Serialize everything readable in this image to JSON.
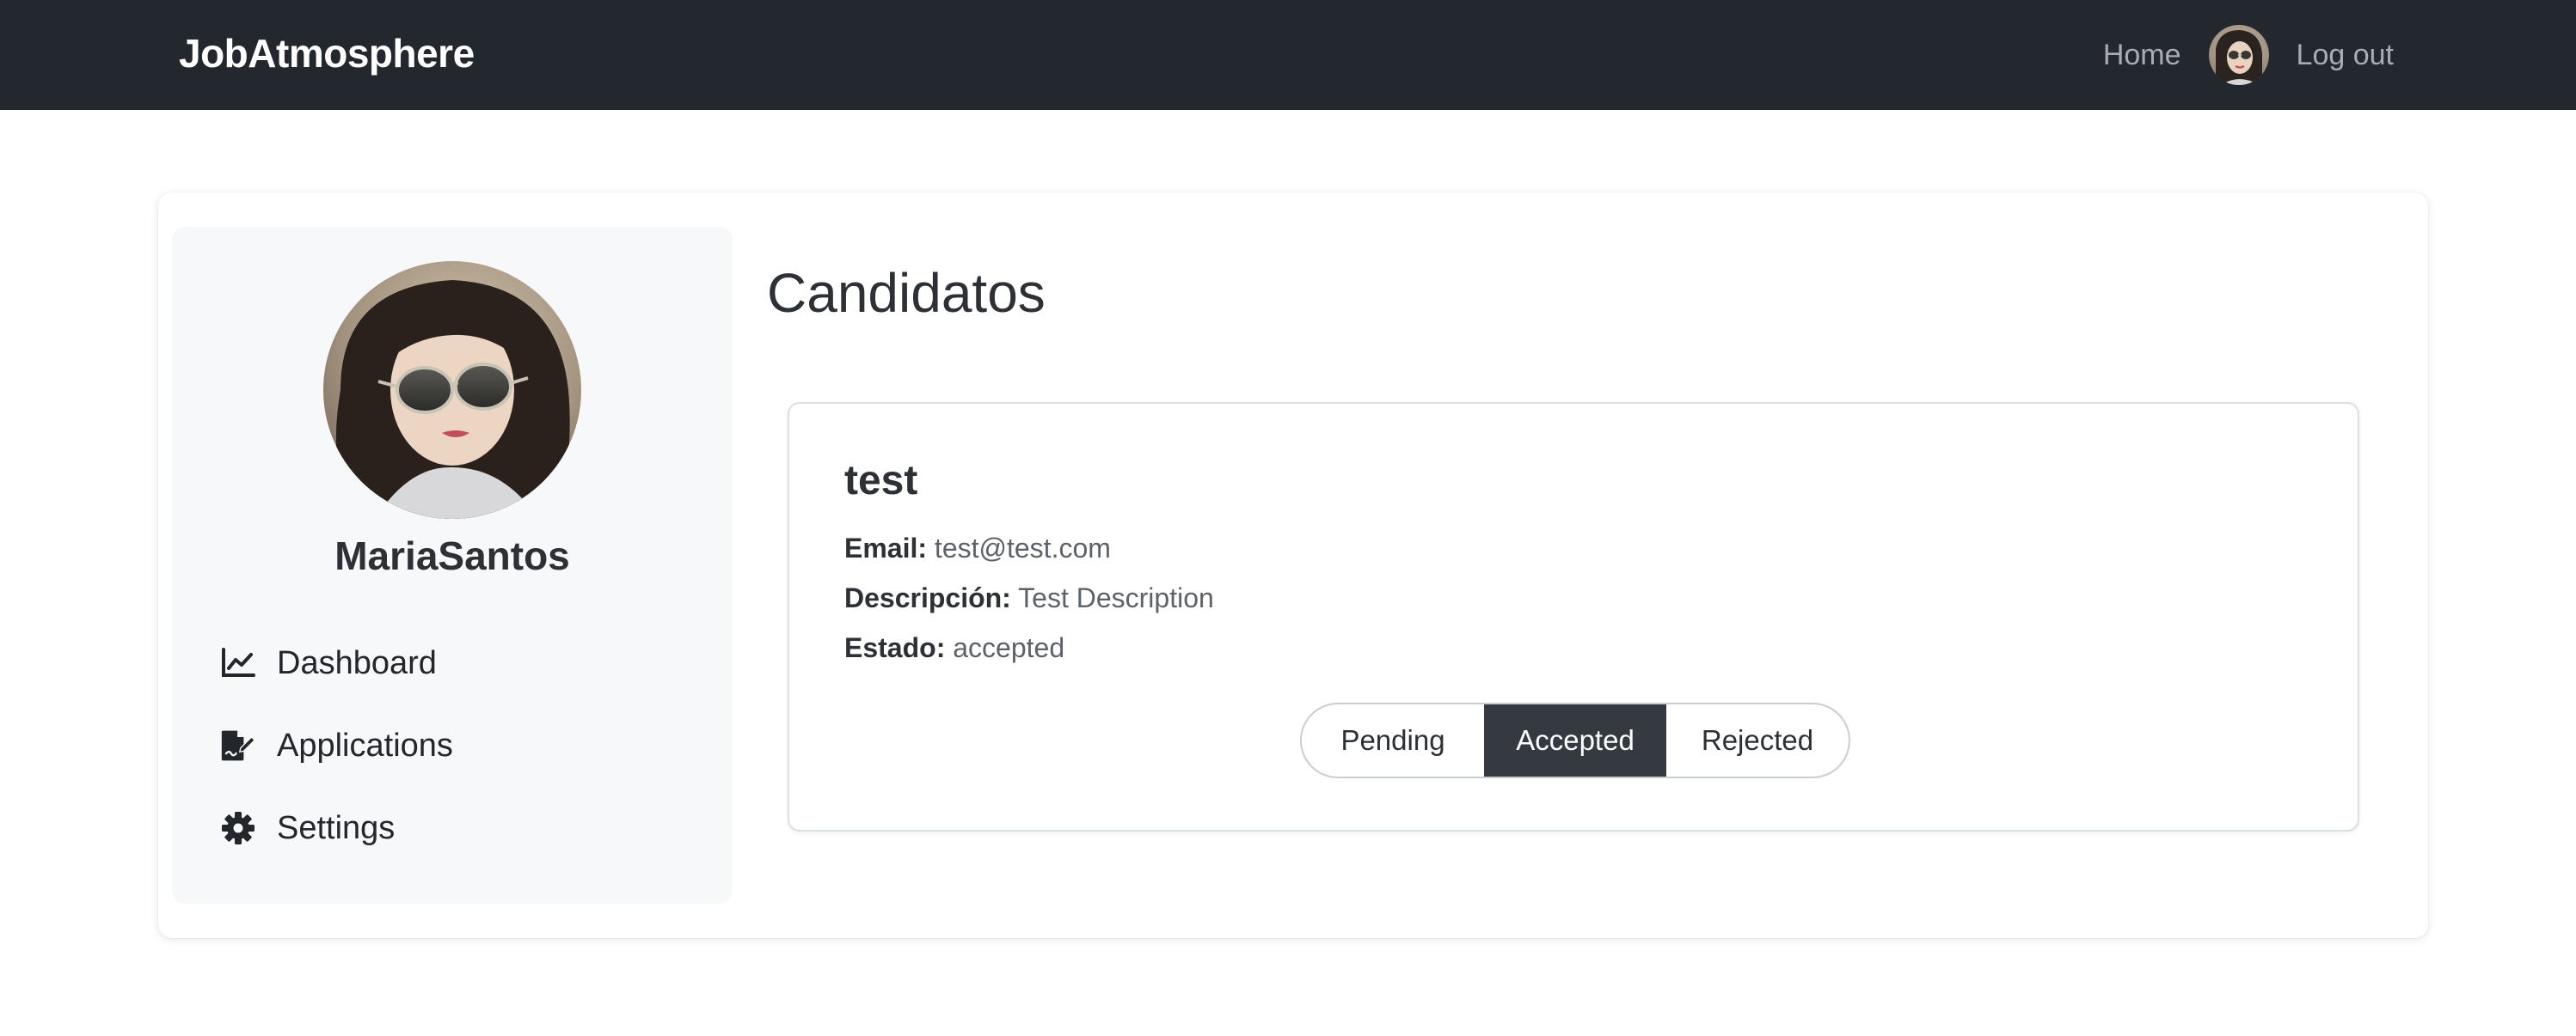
{
  "navbar": {
    "brand": "JobAtmosphere",
    "home_label": "Home",
    "logout_label": "Log out",
    "avatar_icon": "user-avatar"
  },
  "sidebar": {
    "username": "MariaSantos",
    "items": [
      {
        "label": "Dashboard",
        "icon": "chart-line-icon"
      },
      {
        "label": "Applications",
        "icon": "file-signature-icon"
      },
      {
        "label": "Settings",
        "icon": "gear-icon"
      }
    ]
  },
  "main": {
    "title": "Candidatos",
    "candidate": {
      "name": "test",
      "email_label": "Email:",
      "email": "test@test.com",
      "description_label": "Descripción:",
      "description": "Test Description",
      "status_label": "Estado:",
      "status": "accepted"
    },
    "status_buttons": {
      "pending": "Pending",
      "accepted": "Accepted",
      "rejected": "Rejected",
      "selected": "accepted"
    }
  },
  "colors": {
    "navbar_bg": "#23272e",
    "selected_button_bg": "#343a40",
    "sidebar_bg": "#f7f8fa"
  }
}
